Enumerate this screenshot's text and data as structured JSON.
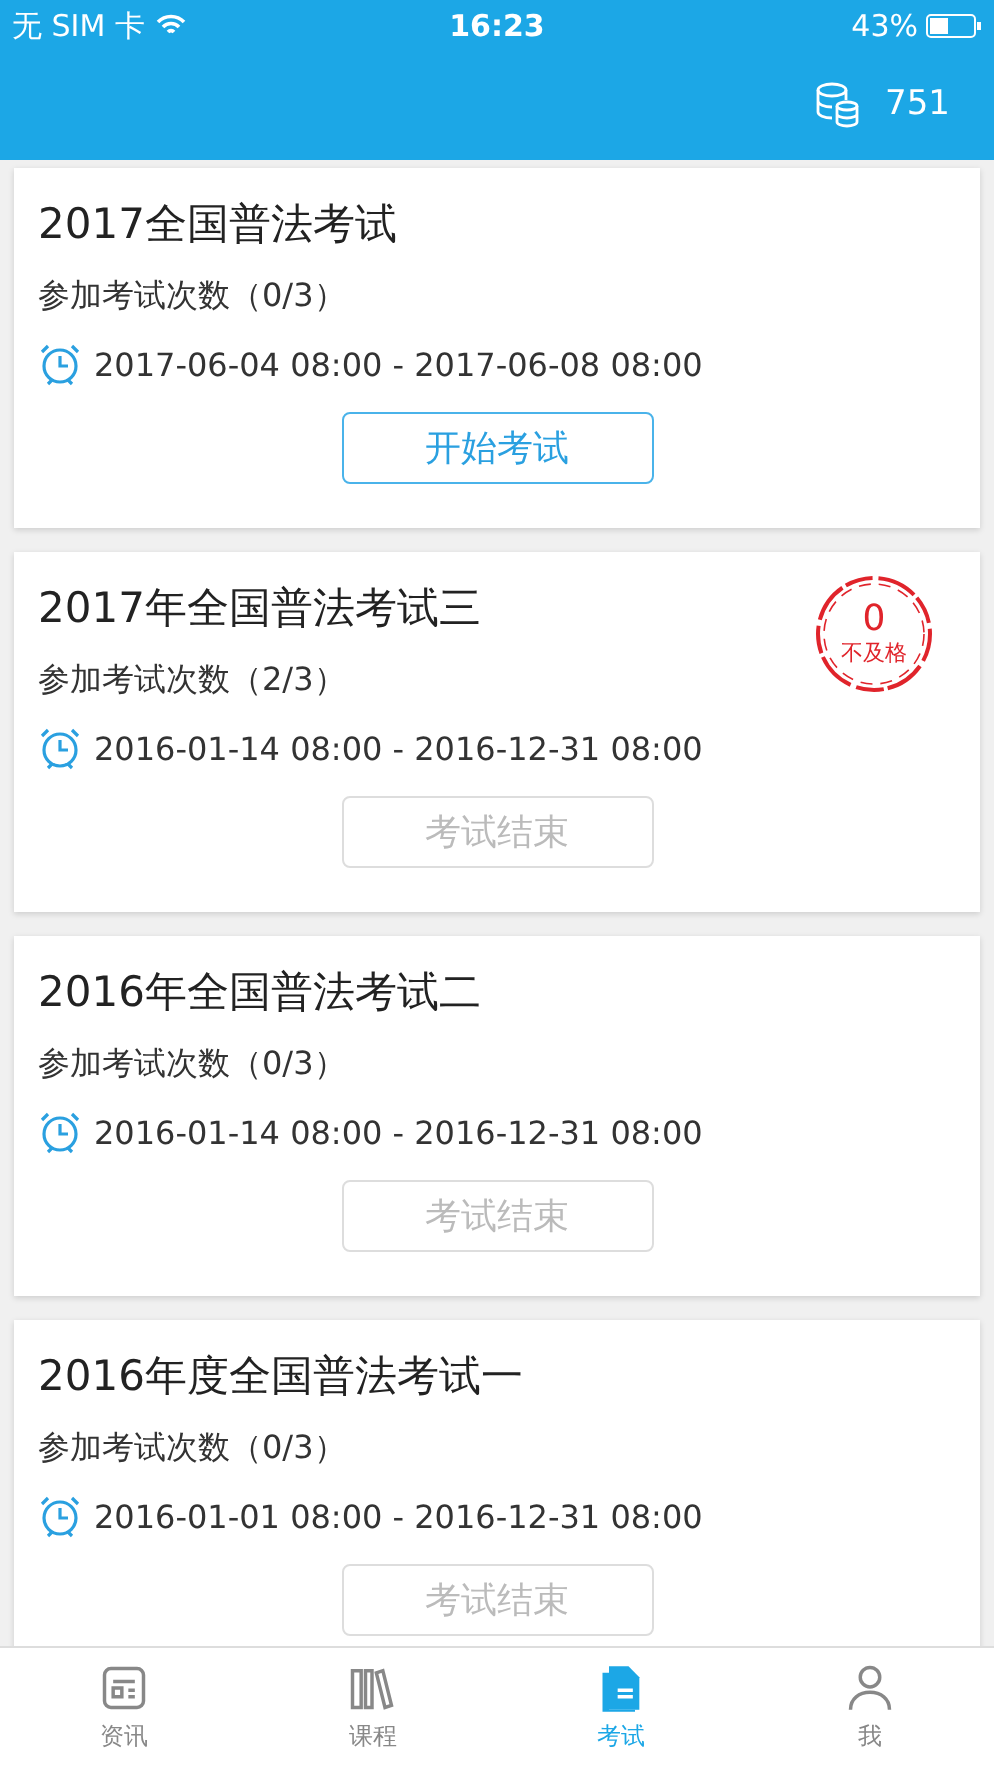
{
  "status_bar": {
    "carrier": "无 SIM 卡",
    "time": "16:23",
    "battery": "43%"
  },
  "header": {
    "coins": "751"
  },
  "exams": [
    {
      "title": "2017全国普法考试",
      "attempts": "参加考试次数（0/3）",
      "period": "2017-06-04 08:00 - 2017-06-08 08:00",
      "button": {
        "label": "开始考试",
        "disabled": false
      }
    },
    {
      "title": "2017年全国普法考试三",
      "attempts": "参加考试次数（2/3）",
      "period": "2016-01-14 08:00 - 2016-12-31 08:00",
      "button": {
        "label": "考试结束",
        "disabled": true
      },
      "stamp": {
        "score": "0",
        "label": "不及格"
      }
    },
    {
      "title": "2016年全国普法考试二",
      "attempts": "参加考试次数（0/3）",
      "period": "2016-01-14 08:00 - 2016-12-31 08:00",
      "button": {
        "label": "考试结束",
        "disabled": true
      }
    },
    {
      "title": "2016年度全国普法考试一",
      "attempts": "参加考试次数（0/3）",
      "period": "2016-01-01 08:00 - 2016-12-31 08:00",
      "button": {
        "label": "考试结束",
        "disabled": true
      }
    }
  ],
  "tabs": [
    {
      "label": "资讯",
      "kind": "news",
      "selected": false
    },
    {
      "label": "课程",
      "kind": "books",
      "selected": false
    },
    {
      "label": "考试",
      "kind": "exam",
      "selected": true
    },
    {
      "label": "我",
      "kind": "me",
      "selected": false
    }
  ]
}
